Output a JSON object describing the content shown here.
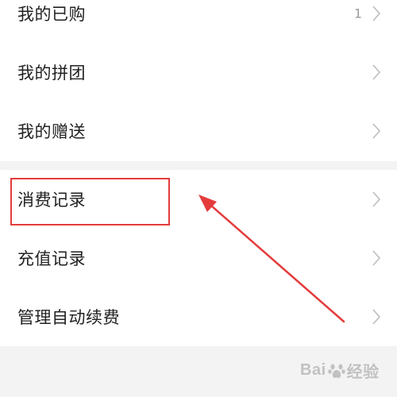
{
  "menu": {
    "section1": [
      {
        "label": "我的已购",
        "count": "1"
      },
      {
        "label": "我的拼团"
      },
      {
        "label": "我的赠送"
      }
    ],
    "section2": [
      {
        "label": "消费记录"
      },
      {
        "label": "充值记录"
      },
      {
        "label": "管理自动续费"
      }
    ]
  },
  "icons": {
    "row_chevron": "chevron-right-icon"
  },
  "annotation": {
    "color": "#e43b3b",
    "highlighted_item": "消费记录"
  },
  "watermark": {
    "left": "Bai",
    "right": "经验"
  }
}
